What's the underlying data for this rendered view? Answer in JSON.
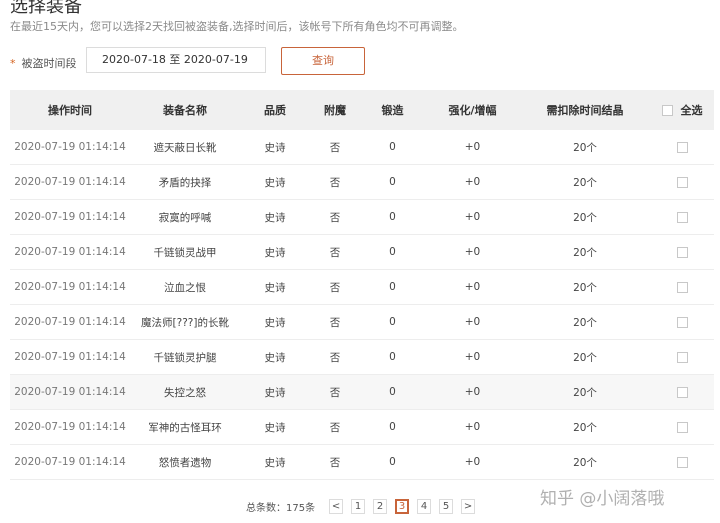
{
  "page": {
    "title": "选择装备",
    "subtitle": "在最近15天内，您可以选择2天找回被盗装备,选择时间后，该帐号下所有角色均不可再调整。"
  },
  "filter": {
    "required_mark": "*",
    "label": "被盗时间段",
    "date_range": "2020-07-18 至 2020-07-19",
    "query_label": "查询"
  },
  "table": {
    "headers": [
      "操作时间",
      "装备名称",
      "品质",
      "附魔",
      "锻造",
      "强化/增幅",
      "需扣除时间结晶",
      "全选"
    ],
    "rows": [
      {
        "time": "2020-07-19 01:14:14",
        "name": "遮天蔽日长靴",
        "quality": "史诗",
        "enchant": "否",
        "forge": "0",
        "enhance": "+0",
        "cost": "20个"
      },
      {
        "time": "2020-07-19 01:14:14",
        "name": "矛盾的抉择",
        "quality": "史诗",
        "enchant": "否",
        "forge": "0",
        "enhance": "+0",
        "cost": "20个"
      },
      {
        "time": "2020-07-19 01:14:14",
        "name": "寂寞的呼喊",
        "quality": "史诗",
        "enchant": "否",
        "forge": "0",
        "enhance": "+0",
        "cost": "20个"
      },
      {
        "time": "2020-07-19 01:14:14",
        "name": "千链锁灵战甲",
        "quality": "史诗",
        "enchant": "否",
        "forge": "0",
        "enhance": "+0",
        "cost": "20个"
      },
      {
        "time": "2020-07-19 01:14:14",
        "name": "泣血之恨",
        "quality": "史诗",
        "enchant": "否",
        "forge": "0",
        "enhance": "+0",
        "cost": "20个"
      },
      {
        "time": "2020-07-19 01:14:14",
        "name": "魔法师[???]的长靴",
        "quality": "史诗",
        "enchant": "否",
        "forge": "0",
        "enhance": "+0",
        "cost": "20个"
      },
      {
        "time": "2020-07-19 01:14:14",
        "name": "千链锁灵护腿",
        "quality": "史诗",
        "enchant": "否",
        "forge": "0",
        "enhance": "+0",
        "cost": "20个"
      },
      {
        "time": "2020-07-19 01:14:14",
        "name": "失控之怒",
        "quality": "史诗",
        "enchant": "否",
        "forge": "0",
        "enhance": "+0",
        "cost": "20个"
      },
      {
        "time": "2020-07-19 01:14:14",
        "name": "军神的古怪耳环",
        "quality": "史诗",
        "enchant": "否",
        "forge": "0",
        "enhance": "+0",
        "cost": "20个"
      },
      {
        "time": "2020-07-19 01:14:14",
        "name": "怒愤者遗物",
        "quality": "史诗",
        "enchant": "否",
        "forge": "0",
        "enhance": "+0",
        "cost": "20个"
      }
    ]
  },
  "pagination": {
    "total_label": "总条数：175条",
    "prev": "<",
    "pages": [
      "1",
      "2",
      "3",
      "4",
      "5"
    ],
    "current": "3",
    "next": ">"
  },
  "watermark": "知乎 @小阔落哦",
  "colors": {
    "accent": "#c8643a",
    "header_bg": "#f0f0f0",
    "highlight_row_bg": "#f7f7f7"
  }
}
